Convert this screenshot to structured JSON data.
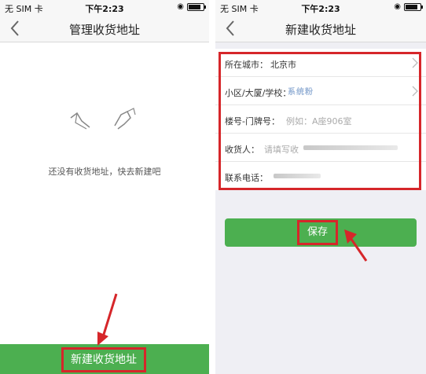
{
  "status_bar": {
    "carrier": "无 SIM 卡",
    "time": "下午2:23",
    "battery_level": 0.85
  },
  "left_screen": {
    "title": "管理收货地址",
    "back_icon": "chevron-left-icon",
    "empty_icon": "empty-box-illustration-icon",
    "empty_message": "还没有收货地址，快去新建吧",
    "new_address_button": "新建收货地址"
  },
  "right_screen": {
    "title": "新建收货地址",
    "back_icon": "chevron-left-icon",
    "watermark": "系统粉",
    "form": {
      "city": {
        "label": "所在城市：",
        "value": "北京市"
      },
      "community": {
        "label": "小区/大厦/学校："
      },
      "building": {
        "label": "楼号-门牌号：",
        "placeholder": "例如：A座906室"
      },
      "receiver": {
        "label": "收货人：",
        "placeholder": "请填写收"
      },
      "phone": {
        "label": "联系电话："
      }
    },
    "save_button": "保存"
  },
  "colors": {
    "accent_green": "#4caf50",
    "highlight_red": "#d6262a"
  }
}
